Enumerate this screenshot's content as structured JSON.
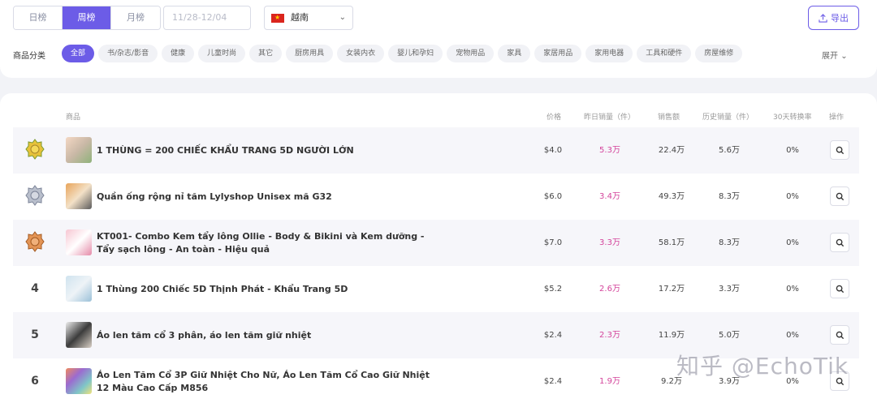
{
  "period_tabs": [
    {
      "label": "日榜",
      "active": false
    },
    {
      "label": "周榜",
      "active": true
    },
    {
      "label": "月榜",
      "active": false
    }
  ],
  "date_range": {
    "placeholder": "11/28-12/04"
  },
  "country": {
    "label": "越南",
    "flag": "vietnam-flag"
  },
  "export": {
    "label": "导出"
  },
  "category_label": "商品分类",
  "categories": [
    {
      "label": "全部",
      "active": true
    },
    {
      "label": "书/杂志/影音"
    },
    {
      "label": "健康"
    },
    {
      "label": "儿童时尚"
    },
    {
      "label": "其它"
    },
    {
      "label": "厨房用具"
    },
    {
      "label": "女装内衣"
    },
    {
      "label": "婴儿和孕妇"
    },
    {
      "label": "宠物用品"
    },
    {
      "label": "家具"
    },
    {
      "label": "家居用品"
    },
    {
      "label": "家用电器"
    },
    {
      "label": "工具和硬件"
    },
    {
      "label": "房屋维修"
    }
  ],
  "expand_label": "展开",
  "table": {
    "headers": {
      "product": "商品",
      "price": "价格",
      "yesterday_sales": "昨日销量（件）",
      "sales_amount": "销售额",
      "history_sales": "历史销量（件）",
      "conversion_30d": "30天转换率",
      "action": "操作"
    },
    "rows": [
      {
        "rank": "1",
        "medal": "gold",
        "name": "1 THÙNG = 200 CHIẾC KHẨU TRANG 5D NGƯỜI LỚN",
        "price": "$4.0",
        "yesterday": "5.3万",
        "sales": "22.4万",
        "history": "5.6万",
        "conv": "0%"
      },
      {
        "rank": "2",
        "medal": "silver",
        "name": "Quần ống rộng nỉ tăm Lylyshop Unisex mã G32",
        "price": "$6.0",
        "yesterday": "3.4万",
        "sales": "49.3万",
        "history": "8.3万",
        "conv": "0%"
      },
      {
        "rank": "3",
        "medal": "bronze",
        "name": "KT001- Combo Kem tẩy lông Ollie - Body & Bikini và Kem dưỡng - Tẩy sạch lông - An toàn - Hiệu quả",
        "price": "$7.0",
        "yesterday": "3.3万",
        "sales": "58.1万",
        "history": "8.3万",
        "conv": "0%"
      },
      {
        "rank": "4",
        "name": "1 Thùng 200 Chiếc 5D Thịnh Phát - Khẩu Trang 5D",
        "price": "$5.2",
        "yesterday": "2.6万",
        "sales": "17.2万",
        "history": "3.3万",
        "conv": "0%"
      },
      {
        "rank": "5",
        "name": "Áo len tăm cổ 3 phân, áo len tăm giữ nhiệt",
        "price": "$2.4",
        "yesterday": "2.3万",
        "sales": "11.9万",
        "history": "5.0万",
        "conv": "0%"
      },
      {
        "rank": "6",
        "name": "Áo Len Tăm Cổ 3P Giữ Nhiệt Cho Nữ, Áo Len Tăm Cổ Cao Giữ Nhiệt 12 Màu Cao Cấp M856",
        "price": "$2.4",
        "yesterday": "1.9万",
        "sales": "9.2万",
        "history": "3.9万",
        "conv": "0%"
      }
    ]
  },
  "watermark": "知乎 @EchoTik",
  "colors": {
    "accent": "#6c5ce7",
    "pink": "#d4449b"
  }
}
